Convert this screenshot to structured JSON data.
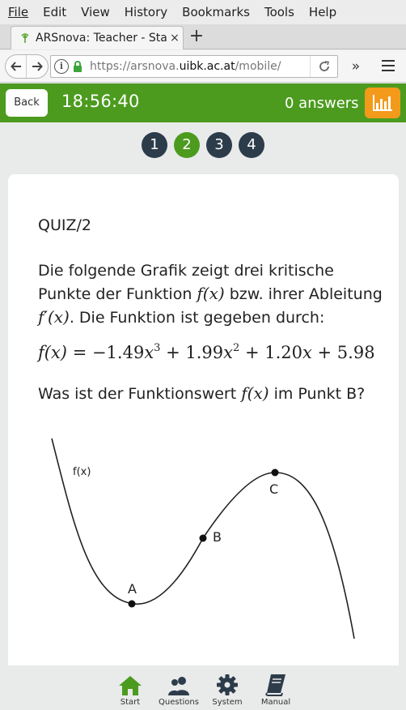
{
  "browser": {
    "menu": [
      "File",
      "Edit",
      "View",
      "History",
      "Bookmarks",
      "Tools",
      "Help"
    ],
    "tab_title": "ARSnova: Teacher - Sta",
    "tab_close": "×",
    "new_tab": "+",
    "url_prefix": "https://arsnova.",
    "url_domain": "uibk.ac.at",
    "url_suffix": "/mobile/",
    "overflow": "»"
  },
  "header": {
    "back_label": "Back",
    "timer": "18:56:40",
    "answers": "0 answers",
    "accent": "#4c9b1f",
    "stats_color": "#f39a1b"
  },
  "pager": {
    "pages": [
      "1",
      "2",
      "3",
      "4"
    ],
    "active": "2"
  },
  "question": {
    "id": "QUIZ/2",
    "text_1": "Die folgende Grafik zeigt drei kritische Punkte der Funktion ",
    "math_f": "f(x)",
    "text_2": " bzw. ihrer Ableitung ",
    "math_fprime": "f′(x)",
    "text_3": ". Die Funktion ist gegeben durch:",
    "formula": {
      "lhs": "f(x)",
      "eq": " = −1.49",
      "x1": "x",
      "p1": "3",
      "t2": " + 1.99",
      "x2": "x",
      "p2": "2",
      "t3": " + 1.20",
      "x3": "x",
      "t4": " + 5.98"
    },
    "ask_1": "Was ist der Funktionswert ",
    "ask_math": "f(x)",
    "ask_2": " im Punkt B?"
  },
  "graph": {
    "curve_label": "f(x)",
    "points": [
      "A",
      "B",
      "C"
    ]
  },
  "bottom_nav": [
    {
      "label": "Start",
      "icon": "home-icon"
    },
    {
      "label": "Questions",
      "icon": "users-icon"
    },
    {
      "label": "System",
      "icon": "gear-icon"
    },
    {
      "label": "Manual",
      "icon": "book-icon"
    }
  ]
}
